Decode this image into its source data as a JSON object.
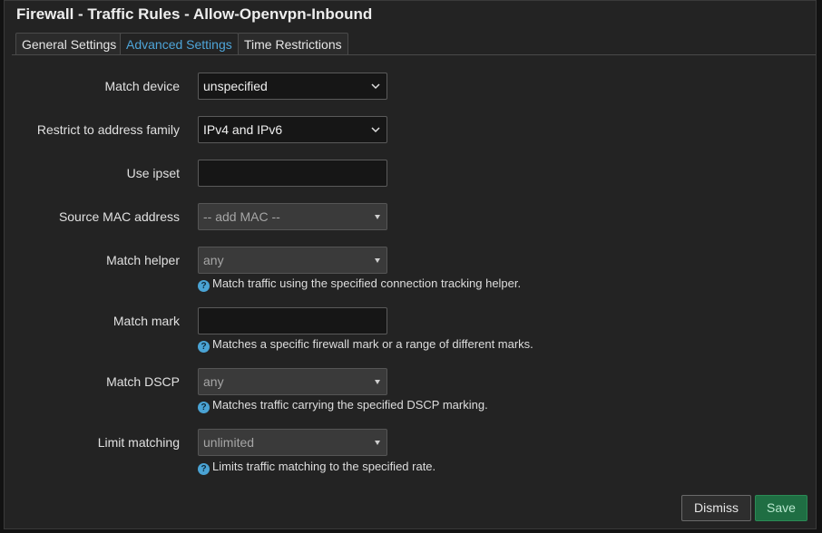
{
  "title": "Firewall - Traffic Rules - Allow-Openvpn-Inbound",
  "tabs": [
    {
      "label": "General Settings"
    },
    {
      "label": "Advanced Settings"
    },
    {
      "label": "Time Restrictions"
    }
  ],
  "active_tab": "Advanced Settings",
  "fields": {
    "match_device": {
      "label": "Match device",
      "value": "unspecified"
    },
    "address_family": {
      "label": "Restrict to address family",
      "value": "IPv4 and IPv6"
    },
    "ipset": {
      "label": "Use ipset",
      "value": ""
    },
    "source_mac": {
      "label": "Source MAC address",
      "value": "-- add MAC --"
    },
    "match_helper": {
      "label": "Match helper",
      "value": "any",
      "help": "Match traffic using the specified connection tracking helper."
    },
    "match_mark": {
      "label": "Match mark",
      "value": "",
      "help": "Matches a specific firewall mark or a range of different marks."
    },
    "match_dscp": {
      "label": "Match DSCP",
      "value": "any",
      "help": "Matches traffic carrying the specified DSCP marking."
    },
    "limit_matching": {
      "label": "Limit matching",
      "value": "unlimited",
      "help": "Limits traffic matching to the specified rate."
    }
  },
  "buttons": {
    "dismiss": "Dismiss",
    "save": "Save"
  },
  "icons": {
    "help": "question-circle-icon",
    "dropdown": "chevron-down-icon",
    "dropdown_small": "caret-down-icon"
  },
  "colors": {
    "accent": "#4ea5d9",
    "save": "#1f6e43"
  }
}
